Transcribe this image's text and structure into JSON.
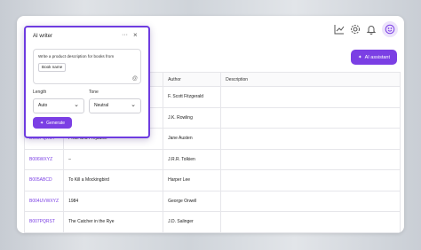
{
  "toolbar": {
    "icons": [
      "chart-icon",
      "gear-icon",
      "bell-icon",
      "smiley-icon"
    ],
    "ai_assistant_label": "AI assistant"
  },
  "table": {
    "headers": [
      "",
      "",
      "Author",
      "Description"
    ],
    "rows": [
      {
        "code": "",
        "title": "",
        "author": "F. Scott Fitzgerald"
      },
      {
        "code": "",
        "title": "",
        "author": "J.K. Rowling"
      },
      {
        "code": "B005PQRST",
        "title": "Pride and Prejudice",
        "author": "Jane Austen"
      },
      {
        "code": "B006WXYZ",
        "title": "–",
        "author": "J.R.R. Tolkien"
      },
      {
        "code": "B005ABCD",
        "title": "To Kill a Mockingbird",
        "author": "Harper Lee"
      },
      {
        "code": "B004UVWXYZ",
        "title": "1984",
        "author": "George Orwell"
      },
      {
        "code": "B007PQRST",
        "title": "The Catcher in the Rye",
        "author": "J.D. Salinger"
      }
    ]
  },
  "panel": {
    "title": "AI writer",
    "more_label": "···",
    "close_label": "×",
    "prompt_text": "Write a product description for books from",
    "chip_label": "Book name",
    "at_symbol": "@",
    "length_label": "Length",
    "length_value": "Auto",
    "tone_label": "Tone",
    "tone_value": "Neutral",
    "generate_label": "Generate"
  },
  "colors": {
    "accent": "#7b3fe4",
    "panel_border": "#6e3ce0"
  }
}
